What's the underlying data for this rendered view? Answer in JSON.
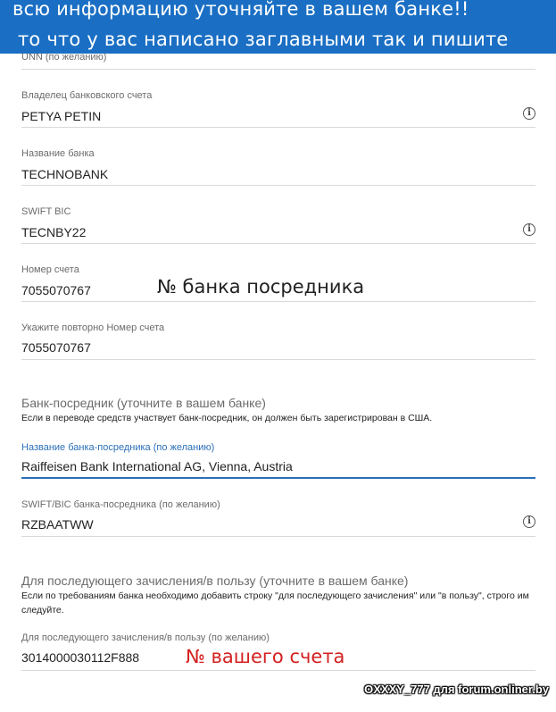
{
  "banner": {
    "line1": "всю информацию уточняйте в вашем банке!!",
    "line2": "то что у вас написано заглавными так и пишите"
  },
  "fields": {
    "unn": {
      "label": "UNN (по желанию)"
    },
    "owner": {
      "label": "Владелец банковского счета",
      "value": "PETYA PETIN"
    },
    "bank_name": {
      "label": "Название банка",
      "value": "TECHNOBANK"
    },
    "swift": {
      "label": "SWIFT BIC",
      "value": "TECNBY22"
    },
    "account": {
      "label": "Номер счета",
      "value": "7055070767"
    },
    "account_repeat": {
      "label": "Укажите повторно Номер счета",
      "value": "7055070767"
    },
    "intermediary_name": {
      "label": "Название банка-посредника (по желанию)",
      "value": "Raiffeisen Bank International AG, Vienna, Austria"
    },
    "intermediary_swift": {
      "label": "SWIFT/BIC банка-посредника (по желанию)",
      "value": "RZBAATWW"
    },
    "further_credit": {
      "label": "Для последующего зачисления/в пользу (по желанию)",
      "value": "3014000030112F888"
    }
  },
  "sections": {
    "intermediary": {
      "title": "Банк-посредник (уточните в вашем банке)",
      "note": "Если в переводе средств участвует банк-посредник, он должен быть зарегистрирован в США."
    },
    "further_credit": {
      "title": "Для последующего зачисления/в пользу (уточните в вашем банке)",
      "note": "Если по требованиям банка необходимо добавить строку \"для последующего зачисления\" или \"в пользу\", строго им следуйте."
    }
  },
  "annotations": {
    "intermediary_bank_no": "№ банка посредника",
    "your_account_no": "№ вашего счета"
  },
  "icons": {
    "info": "info-icon"
  },
  "colors": {
    "accent": "#2a6fb8",
    "banner": "#1a6fc4",
    "annotation_red": "#d42020"
  },
  "watermark": "OXXXY_777 для forum.onliner.by"
}
